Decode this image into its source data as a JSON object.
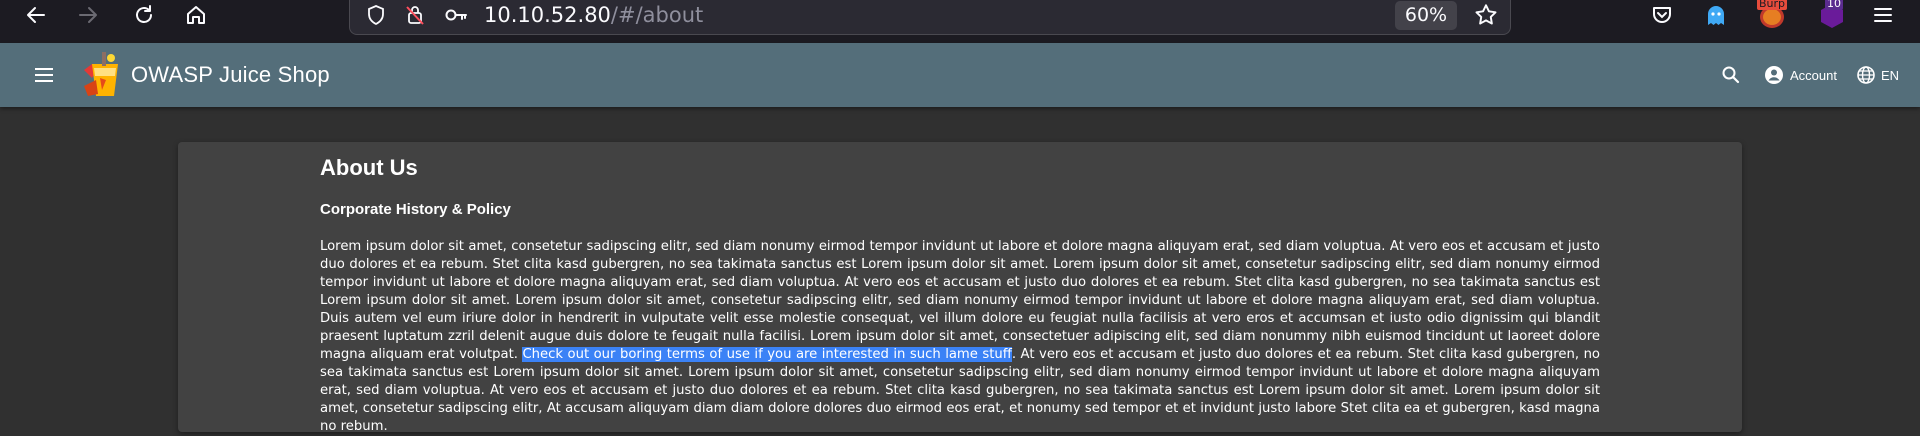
{
  "browser": {
    "url_host": "10.10.52.80",
    "url_path": "/#/about",
    "zoom": "60%",
    "extension_badges": {
      "burp": "Burp",
      "count": "10"
    }
  },
  "app": {
    "title": "OWASP Juice Shop",
    "account_label": "Account",
    "language_label": "EN"
  },
  "about": {
    "title": "About Us",
    "subtitle": "Corporate History & Policy",
    "text_before": "Lorem ipsum dolor sit amet, consetetur sadipscing elitr, sed diam nonumy eirmod tempor invidunt ut labore et dolore magna aliquyam erat, sed diam voluptua. At vero eos et accusam et justo duo dolores et ea rebum. Stet clita kasd gubergren, no sea takimata sanctus est Lorem ipsum dolor sit amet. Lorem ipsum dolor sit amet, consetetur sadipscing elitr, sed diam nonumy eirmod tempor invidunt ut labore et dolore magna aliquyam erat, sed diam voluptua. At vero eos et accusam et justo duo dolores et ea rebum. Stet clita kasd gubergren, no sea takimata sanctus est Lorem ipsum dolor sit amet. Lorem ipsum dolor sit amet, consetetur sadipscing elitr, sed diam nonumy eirmod tempor invidunt ut labore et dolore magna aliquyam erat, sed diam voluptua. Duis autem vel eum iriure dolor in hendrerit in vulputate velit esse molestie consequat, vel illum dolore eu feugiat nulla facilisis at vero eros et accumsan et iusto odio dignissim qui blandit praesent luptatum zzril delenit augue duis dolore te feugait nulla facilisi. Lorem ipsum dolor sit amet, consectetuer adipiscing elit, sed diam nonummy nibh euismod tincidunt ut laoreet dolore magna aliquam erat volutpat. ",
    "link_text": "Check out our boring terms of use if you are interested in such lame stuff",
    "text_after": ". At vero eos et accusam et justo duo dolores et ea rebum. Stet clita kasd gubergren, no sea takimata sanctus est Lorem ipsum dolor sit amet. Lorem ipsum dolor sit amet, consetetur sadipscing elitr, sed diam nonumy eirmod tempor invidunt ut labore et dolore magna aliquyam erat, sed diam voluptua. At vero eos et accusam et justo duo dolores et ea rebum. Stet clita kasd gubergren, no sea takimata sanctus est Lorem ipsum dolor sit amet. Lorem ipsum dolor sit amet, consetetur sadipscing elitr, At accusam aliquyam diam diam dolore dolores duo eirmod eos erat, et nonumy sed tempor et et invidunt justo labore Stet clita ea et gubergren, kasd magna no rebum."
  },
  "colors": {
    "toolbar": "#546e7a",
    "background": "#303030",
    "card": "#424242",
    "selection": "#3b82f6"
  }
}
